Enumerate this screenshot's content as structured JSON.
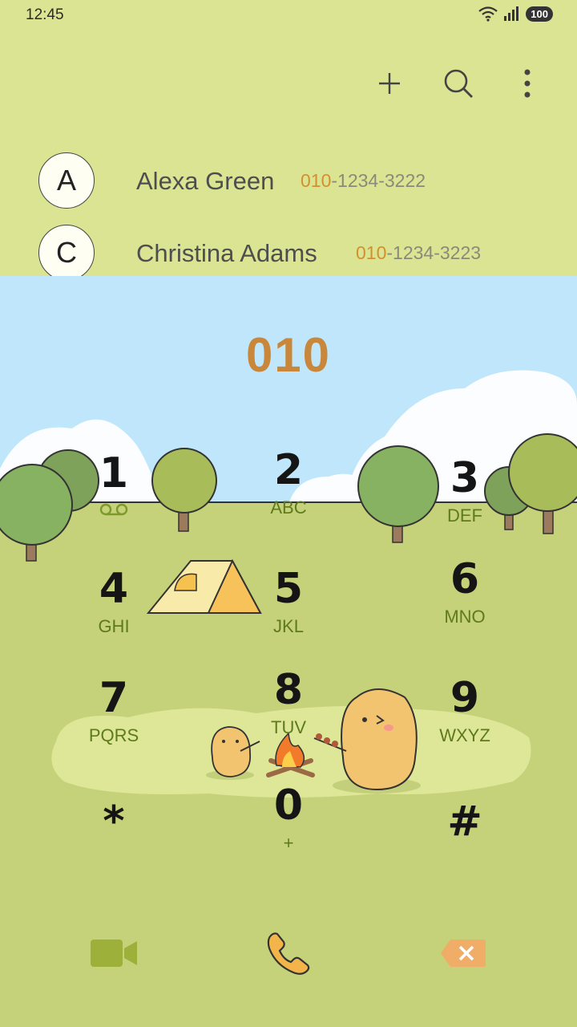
{
  "status": {
    "time": "12:45",
    "battery": "100"
  },
  "toolbar": {
    "add_icon": "plus-icon",
    "search_icon": "search-icon",
    "more_icon": "more-vert-icon"
  },
  "contacts": [
    {
      "initial": "A",
      "name": "Alexa Green",
      "number_match": "010",
      "number_rest": "-1234-3222"
    },
    {
      "initial": "C",
      "name": "Christina Adams",
      "number_match": "010",
      "number_rest": "-1234-3223"
    }
  ],
  "dial": {
    "input": "010"
  },
  "keys": [
    {
      "digit": "1",
      "letters": ""
    },
    {
      "digit": "2",
      "letters": "ABC"
    },
    {
      "digit": "3",
      "letters": "DEF"
    },
    {
      "digit": "4",
      "letters": "GHI"
    },
    {
      "digit": "5",
      "letters": "JKL"
    },
    {
      "digit": "6",
      "letters": "MNO"
    },
    {
      "digit": "7",
      "letters": "PQRS"
    },
    {
      "digit": "8",
      "letters": "TUV"
    },
    {
      "digit": "9",
      "letters": "WXYZ"
    },
    {
      "digit": "*",
      "letters": ""
    },
    {
      "digit": "0",
      "letters": "+"
    },
    {
      "digit": "#",
      "letters": ""
    }
  ],
  "colors": {
    "accent": "#c8873a",
    "top_bg": "#dbe492",
    "sky": "#bfe6fb",
    "grass": "#c6d27a",
    "video": "#9cb03a",
    "call": "#f3b44a",
    "delete": "#f0ad68"
  }
}
